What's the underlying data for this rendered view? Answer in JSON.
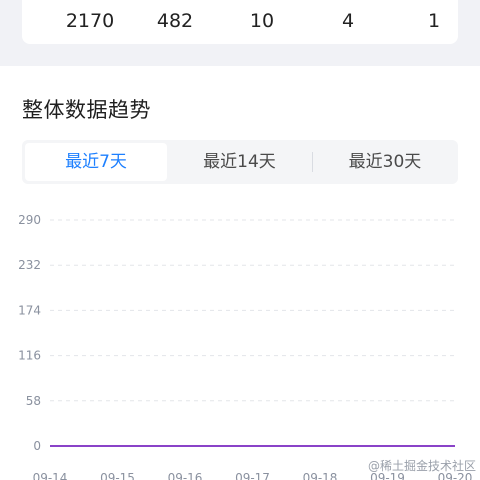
{
  "stats": {
    "values": [
      "2170",
      "482",
      "10",
      "4",
      "1"
    ]
  },
  "section": {
    "title": "整体数据趋势"
  },
  "tabs": [
    {
      "label": "最近7天",
      "active": true
    },
    {
      "label": "最近14天",
      "active": false
    },
    {
      "label": "最近30天",
      "active": false
    }
  ],
  "colors": {
    "accent": "#1e80ff",
    "series": "#8a43c8",
    "grid": "#e3e5e9",
    "axis_text": "#8a919f"
  },
  "chart_data": {
    "type": "line",
    "x": [
      "09-14",
      "09-15",
      "09-16",
      "09-17",
      "09-18",
      "09-19",
      "09-20"
    ],
    "series": [
      {
        "values": [
          0,
          0,
          0,
          0,
          0,
          0,
          0
        ]
      }
    ],
    "yticks": [
      "290",
      "232",
      "174",
      "116",
      "58",
      "0"
    ],
    "ylim": [
      0,
      290
    ],
    "grid": true
  },
  "watermark": "@稀土掘金技术社区"
}
